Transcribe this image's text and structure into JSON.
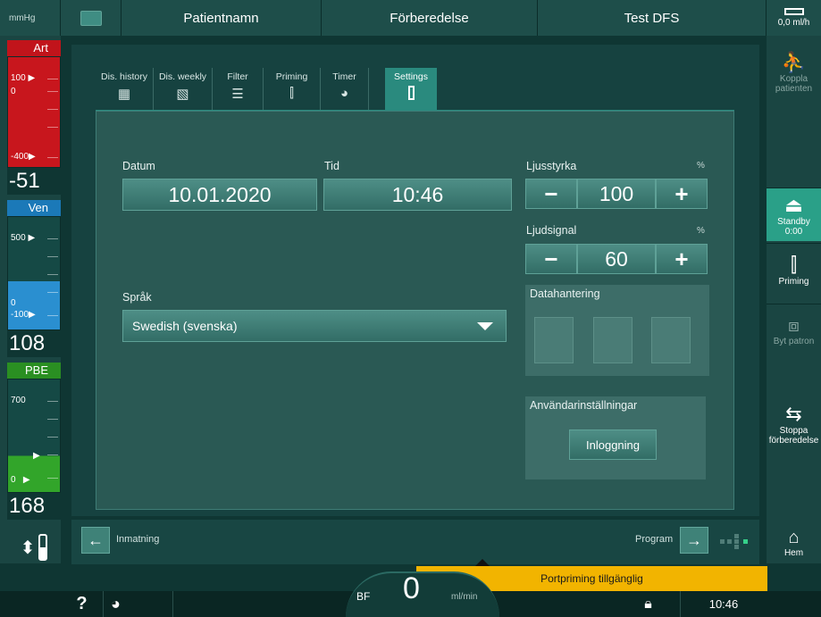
{
  "topbar": {
    "unit": "mmHg",
    "patient_name": "Patientnamn",
    "mode": "Förberedelse",
    "program": "Test DFS",
    "uf_value": "0,0",
    "uf_unit": "ml/h"
  },
  "gauges": {
    "art": {
      "label": "Art",
      "top_label": "100",
      "zero_label": "0",
      "low_label": "-400",
      "value": "-51",
      "color": "#d2232a"
    },
    "ven": {
      "label": "Ven",
      "top_label": "500",
      "zero_label": "0",
      "low_label": "-100",
      "value": "108",
      "color": "#2a8fd0"
    },
    "pbe": {
      "label": "PBE",
      "top_label": "700",
      "zero_label": "0",
      "value": "168",
      "color": "#32a52a"
    }
  },
  "tabs": [
    {
      "label": "Dis. history",
      "icon": "dis-history-icon"
    },
    {
      "label": "Dis. weekly",
      "icon": "dis-weekly-icon"
    },
    {
      "label": "Filter",
      "icon": "filter-icon"
    },
    {
      "label": "Priming",
      "icon": "priming-icon"
    },
    {
      "label": "Timer",
      "icon": "timer-icon"
    },
    {
      "label": "Settings",
      "icon": "settings-icon",
      "active": true
    }
  ],
  "settings": {
    "date_label": "Datum",
    "date_value": "10.01.2020",
    "time_label": "Tid",
    "time_value": "10:46",
    "brightness_label": "Ljusstyrka",
    "brightness_unit": "%",
    "brightness_value": "100",
    "sound_label": "Ljudsignal",
    "sound_unit": "%",
    "sound_value": "60",
    "language_label": "Språk",
    "language_value": "Swedish (svenska)",
    "data_label": "Datahantering",
    "user_settings_label": "Användarinställningar",
    "login_button": "Inloggning",
    "minus": "−",
    "plus": "+"
  },
  "right_buttons": {
    "connect": "Koppla patienten",
    "standby": "Standby",
    "standby_time": "0:00",
    "priming": "Priming",
    "cartridge": "Byt patron",
    "stop": "Stoppa förberedelse",
    "home": "Hem"
  },
  "navbar": {
    "back_label": "Inmatning",
    "forward_label": "Program"
  },
  "statusbar": {
    "help": "?",
    "bf_label": "BF",
    "bf_value": "0",
    "bf_unit": "ml/min",
    "time": "10:46",
    "notice": "Portpriming tillgänglig"
  }
}
